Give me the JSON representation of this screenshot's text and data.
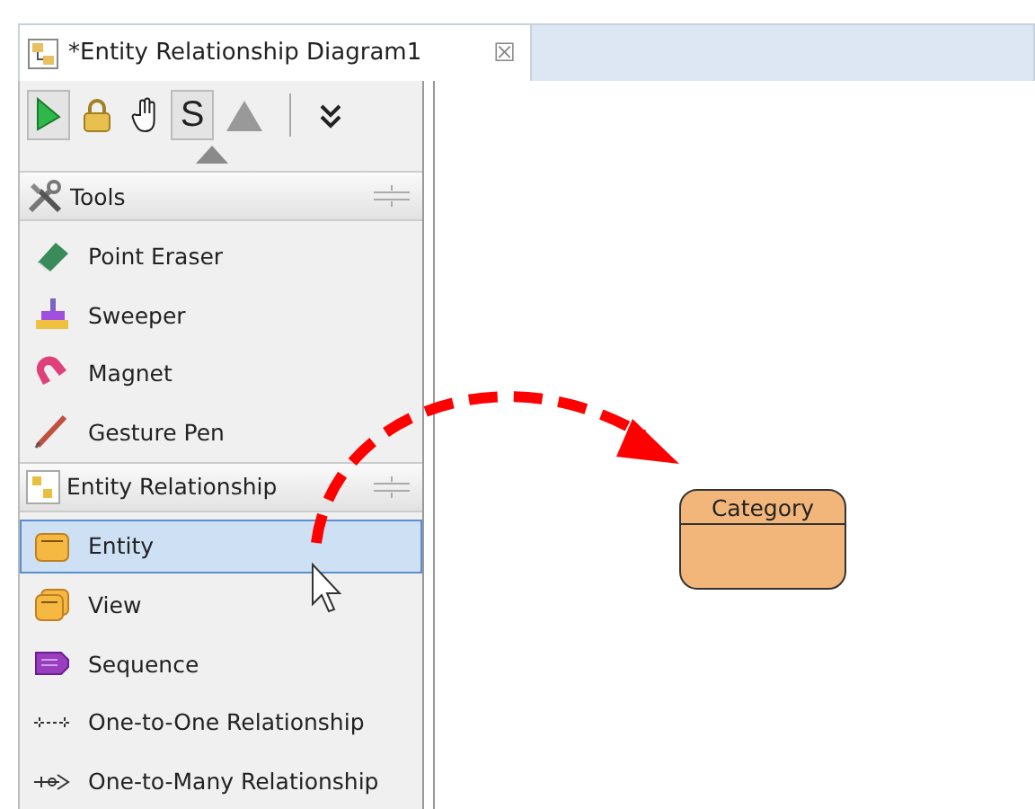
{
  "tab": {
    "title": "*Entity Relationship Diagram1",
    "close": "☒"
  },
  "toolbar": [
    {
      "kind": "select",
      "pressed": true
    },
    {
      "kind": "lock",
      "pressed": false
    },
    {
      "kind": "hand",
      "pressed": false
    },
    {
      "kind": "sweep",
      "label": "S",
      "pressed": true
    },
    {
      "kind": "triangle",
      "pressed": false
    },
    {
      "kind": "more",
      "pressed": false
    }
  ],
  "sections": [
    {
      "title": "Tools",
      "kind": "tools",
      "items": [
        {
          "label": "Point Eraser",
          "kind": "eraser",
          "selected": false
        },
        {
          "label": "Sweeper",
          "kind": "sweeper",
          "selected": false
        },
        {
          "label": "Magnet",
          "kind": "magnet",
          "selected": false
        },
        {
          "label": "Gesture Pen",
          "kind": "pen",
          "selected": false
        }
      ]
    },
    {
      "title": "Entity Relationship",
      "kind": "diagram",
      "items": [
        {
          "label": "Entity",
          "kind": "entity",
          "selected": true
        },
        {
          "label": "View",
          "kind": "view",
          "selected": false
        },
        {
          "label": "Sequence",
          "kind": "sequence",
          "selected": false
        },
        {
          "label": "One-to-One Relationship",
          "kind": "one",
          "selected": false
        },
        {
          "label": "One-to-Many Relationship",
          "kind": "many",
          "selected": false
        }
      ]
    }
  ],
  "canvas": {
    "entity": {
      "name": "Category"
    }
  }
}
